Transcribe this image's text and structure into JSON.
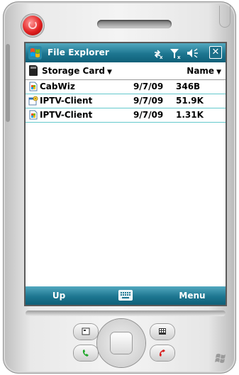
{
  "titlebar": {
    "title": "File Explorer"
  },
  "toolbar": {
    "folder_label": "Storage Card",
    "sort_label": "Name"
  },
  "files": [
    {
      "name": "CabWiz",
      "date": "9/7/09",
      "size": "346B",
      "icon": "document-icon"
    },
    {
      "name": "IPTV-Client",
      "date": "9/7/09",
      "size": "51.9K",
      "icon": "application-icon"
    },
    {
      "name": "IPTV-Client",
      "date": "9/7/09",
      "size": "1.31K",
      "icon": "document-icon"
    }
  ],
  "softkeys": {
    "left": "Up",
    "right": "Menu"
  },
  "colors": {
    "bar_top": "#52a8bf",
    "bar_bottom": "#0f5f78",
    "row_divider": "#64c9cd",
    "power": "#e22222"
  }
}
